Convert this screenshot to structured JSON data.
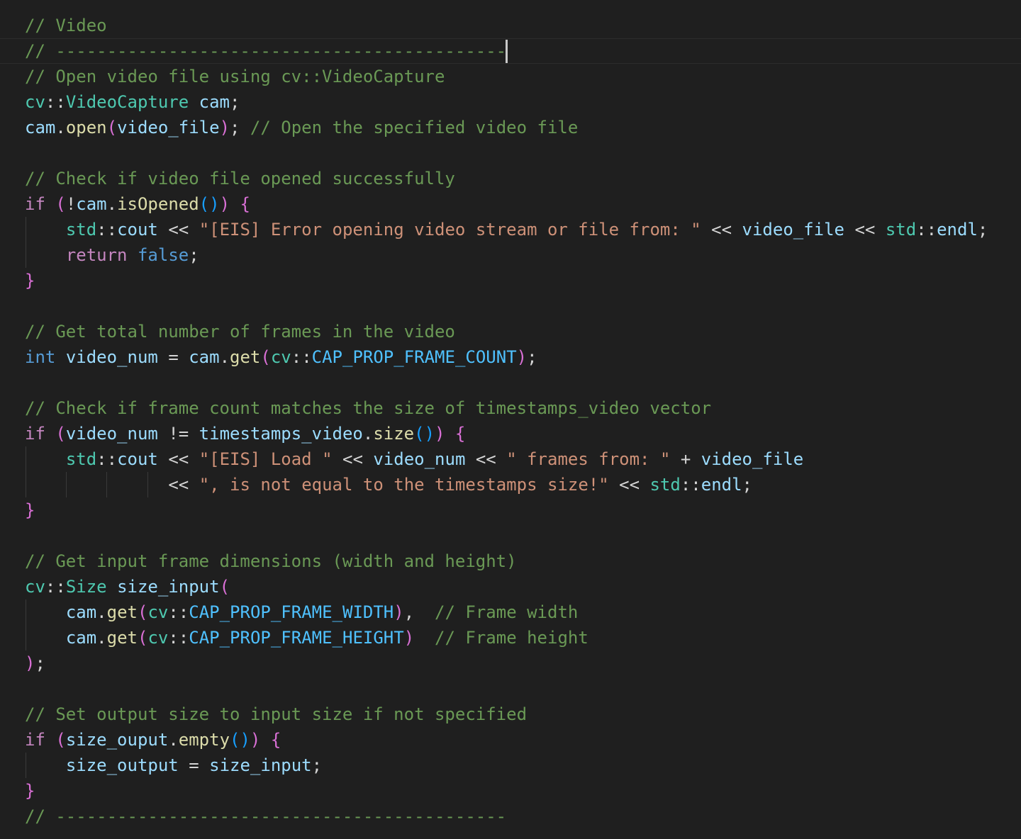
{
  "editor": {
    "lines": [
      "// Video",
      "// --------------------------------------------",
      "// Open video file using cv::VideoCapture",
      "cv::VideoCapture cam;",
      "cam.open(video_file); // Open the specified video file",
      "",
      "// Check if video file opened successfully",
      "if (!cam.isOpened()) {",
      "    std::cout << \"[EIS] Error opening video stream or file from: \" << video_file << std::endl;",
      "    return false;",
      "}",
      "",
      "// Get total number of frames in the video",
      "int video_num = cam.get(cv::CAP_PROP_FRAME_COUNT);",
      "",
      "// Check if frame count matches the size of timestamps_video vector",
      "if (video_num != timestamps_video.size()) {",
      "    std::cout << \"[EIS] Load \" << video_num << \" frames from: \" + video_file",
      "              << \", is not equal to the timestamps size!\" << std::endl;",
      "}",
      "",
      "// Get input frame dimensions (width and height)",
      "cv::Size size_input(",
      "    cam.get(cv::CAP_PROP_FRAME_WIDTH),  // Frame width",
      "    cam.get(cv::CAP_PROP_FRAME_HEIGHT)  // Frame height",
      ");",
      "",
      "// Set output size to input size if not specified",
      "if (size_ouput.empty()) {",
      "    size_output = size_input;",
      "}",
      "// --------------------------------------------"
    ],
    "colors": {
      "background": "#1f1f1f",
      "comment": "#6a9955",
      "namespace_type": "#4ec9b0",
      "variable": "#9cdcfe",
      "function": "#dcdcaa",
      "control_keyword": "#c586c0",
      "keyword": "#569cd6",
      "string": "#ce9178",
      "constant": "#4fc1ff",
      "bracket_level_1": "#da70d6",
      "bracket_level_2": "#179fff"
    }
  }
}
